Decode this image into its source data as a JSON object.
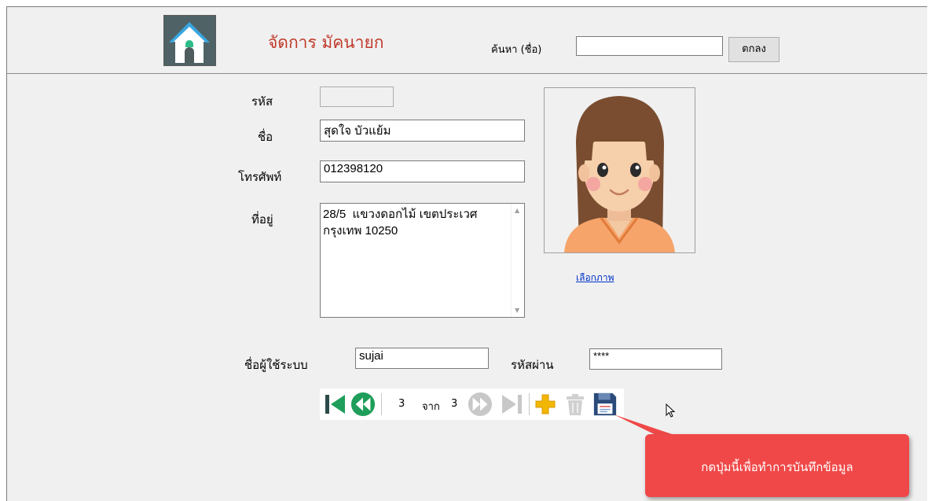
{
  "header": {
    "title": "จัดการ มัคนายก",
    "search_label": "ค้นหา (ชื่อ)",
    "search_value": "",
    "search_button": "ตกลง",
    "home_icon": "home-icon"
  },
  "form": {
    "id_label": "รหัส",
    "id_value": "",
    "name_label": "ชื่อ",
    "name_value": "สุดใจ  บัวแย้ม",
    "phone_label": "โทรศัพท์",
    "phone_value": "012398120",
    "address_label": "ที่อยู่",
    "address_value": "28/5  แขวงดอกไม้ เขตประเวศ\nกรุงเทพ 10250",
    "username_label": "ชื่อผู้ใช้ระบบ",
    "username_value": "sujai",
    "password_label": "รหัสผ่าน",
    "password_value": "****"
  },
  "photo": {
    "select_link": "เลือกภาพ",
    "avatar_icon": "girl-avatar"
  },
  "navigator": {
    "position": "3",
    "of_label": "จาก",
    "total": "3",
    "icons": [
      "first-record-icon",
      "previous-record-icon",
      "next-record-icon",
      "last-record-icon",
      "add-icon",
      "delete-icon",
      "save-icon"
    ]
  },
  "callout": {
    "text": "กดปุ่มนี้เพื่อทำการบันทึกข้อมูล"
  },
  "colors": {
    "title": "#c0392b",
    "callout": "#f04848",
    "nav_green": "#1e9e5a",
    "nav_dark": "#2d4a4a",
    "add_yellow": "#f2b705",
    "save_blue": "#2a4a7a"
  }
}
